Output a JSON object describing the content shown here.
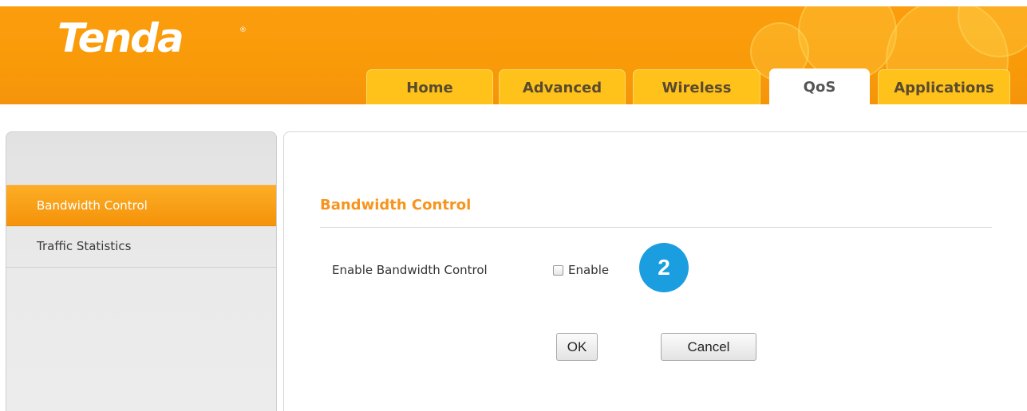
{
  "brand": {
    "logo_text": "Tenda",
    "registered_mark": "®"
  },
  "nav": {
    "tabs": [
      {
        "label": "Home",
        "active": false
      },
      {
        "label": "Advanced",
        "active": false
      },
      {
        "label": "Wireless",
        "active": false
      },
      {
        "label": "QoS",
        "active": true
      },
      {
        "label": "Applications",
        "active": false
      }
    ]
  },
  "sidebar": {
    "items": [
      {
        "label": "Bandwidth Control",
        "active": true
      },
      {
        "label": "Traffic Statistics",
        "active": false
      }
    ]
  },
  "main": {
    "section_title": "Bandwidth Control",
    "field_label": "Enable Bandwidth Control",
    "checkbox_label": "Enable",
    "checkbox_checked": false,
    "step_badge": "2",
    "ok_label": "OK",
    "cancel_label": "Cancel"
  },
  "colors": {
    "header_orange": "#f99a09",
    "tab_yellow": "#ffc21a",
    "accent_orange": "#f7941d",
    "badge_blue": "#1a9ee0"
  },
  "icons": {
    "checkbox": "checkbox-unchecked-icon"
  }
}
